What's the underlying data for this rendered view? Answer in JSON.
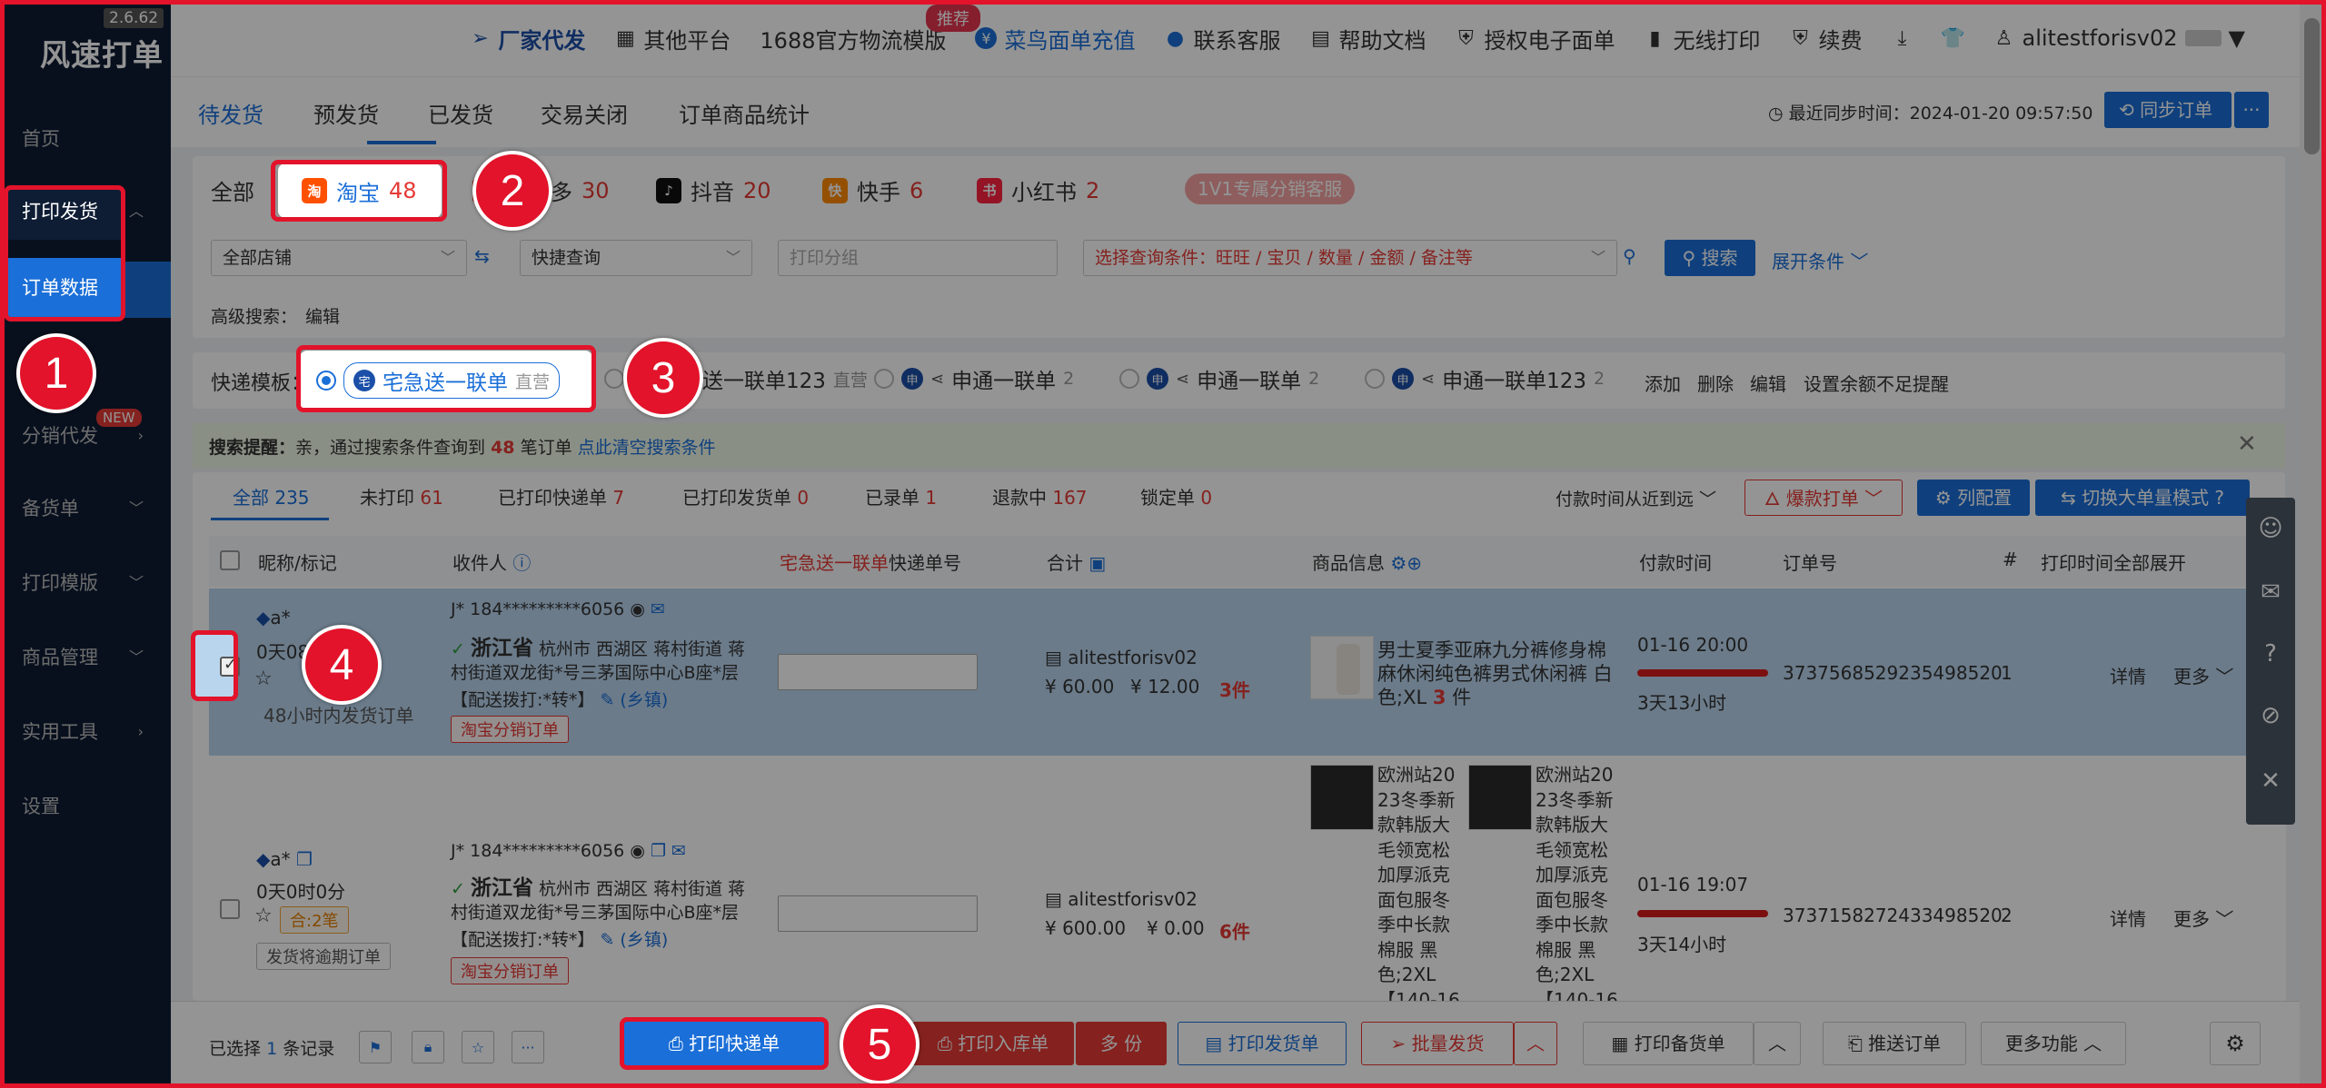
{
  "app": {
    "name": "风速打单",
    "version": "2.6.62"
  },
  "sidebar": {
    "items": [
      {
        "label": "首页"
      },
      {
        "label": "打印发货"
      },
      {
        "label": "订单数据"
      },
      {
        "label": "分销代发",
        "badge": "NEW"
      },
      {
        "label": "备货单"
      },
      {
        "label": "打印模版"
      },
      {
        "label": "商品管理"
      },
      {
        "label": "实用工具"
      },
      {
        "label": "设置"
      }
    ]
  },
  "topbar": {
    "items": [
      {
        "label": "厂家代发",
        "icon": "send-icon"
      },
      {
        "label": "其他平台",
        "icon": "grid-icon"
      },
      {
        "label": "1688官方物流模版",
        "badge": "推荐"
      },
      {
        "label": "菜鸟面单充值",
        "icon": "yen-icon"
      },
      {
        "label": "联系客服",
        "icon": "headset-icon"
      },
      {
        "label": "帮助文档",
        "icon": "doc-icon"
      },
      {
        "label": "授权电子面单",
        "icon": "shield-icon"
      },
      {
        "label": "无线打印",
        "icon": "phone-icon"
      },
      {
        "label": "续费",
        "icon": "shield-yen-icon"
      }
    ],
    "user": "alitestforisv02"
  },
  "tabs": [
    {
      "label": "待发货",
      "active": true
    },
    {
      "label": "预发货"
    },
    {
      "label": "已发货"
    },
    {
      "label": "交易关闭"
    },
    {
      "label": "订单商品统计"
    }
  ],
  "sync": {
    "label": "最近同步时间：2024-01-20 09:57:50",
    "button": "同步订单",
    "more": "···"
  },
  "platforms": [
    {
      "label": "全部"
    },
    {
      "label": "淘宝",
      "count": "48",
      "color": "#ff5000",
      "icon": "淘"
    },
    {
      "label": "拼多多",
      "count": "30",
      "color": "#e02e24",
      "icon": "拼"
    },
    {
      "label": "抖音",
      "count": "20",
      "color": "#111111",
      "icon": "♪"
    },
    {
      "label": "快手",
      "count": "6",
      "color": "#ff8a00",
      "icon": "快"
    },
    {
      "label": "小红书",
      "count": "2",
      "color": "#ff2442",
      "icon": "书"
    }
  ],
  "vip_service": "1V1专属分销客服",
  "search": {
    "shop_select": "全部店铺",
    "quick_select": "快捷查询",
    "group_placeholder": "打印分组",
    "condition_placeholder": "选择查询条件：旺旺 / 宝贝 / 数量 / 金额 / 备注等",
    "search_button": "搜索",
    "expand": "展开条件",
    "advanced_label": "高级搜索：",
    "advanced_edit": "编辑"
  },
  "templates": {
    "label": "快递模板：",
    "items": [
      {
        "name": "宅急送一联单",
        "sub": "直营",
        "selected": true
      },
      {
        "name": "宅急送一联单123",
        "sub": "直营"
      },
      {
        "name": "申通一联单",
        "sub": "2"
      },
      {
        "name": "申通一联单",
        "sub": "2"
      },
      {
        "name": "申通一联单123",
        "sub": "2"
      }
    ],
    "actions": [
      "添加",
      "删除",
      "编辑",
      "设置余额不足提醒"
    ]
  },
  "notice": {
    "prefix": "搜索提醒：",
    "text1": "亲，通过搜索条件查询到",
    "count": "48",
    "text2": "笔订单",
    "clear": "点此清空搜索条件"
  },
  "filters": [
    {
      "label": "全部",
      "count": "235",
      "active": true
    },
    {
      "label": "未打印",
      "count": "61"
    },
    {
      "label": "已打印快递单",
      "count": "7"
    },
    {
      "label": "已打印发货单",
      "count": "0"
    },
    {
      "label": "已录单",
      "count": "1"
    },
    {
      "label": "退款中",
      "count": "167"
    },
    {
      "label": "锁定单",
      "count": "0"
    }
  ],
  "sort": "付款时间从近到远",
  "list_actions": {
    "hot": "爆款打单",
    "columns": "列配置",
    "mode": "切换大单量模式"
  },
  "table": {
    "headers": {
      "nick": "昵称/标记",
      "receiver": "收件人",
      "tracking_prefix": "宅急送一联单",
      "tracking_suffix": "快递单号",
      "total": "合计",
      "goods": "商品信息",
      "paytime": "付款时间",
      "order_no": "订单号",
      "index": "#",
      "print_time": "打印时间",
      "expand_all": "全部展开"
    },
    "rows": [
      {
        "nick": "a*",
        "wait": "0天08",
        "remain": "48小时内发货订单",
        "phone": "J* 184*********6056",
        "province": "浙江省",
        "addr1": "杭州市 西湖区 蒋村街道 蒋",
        "addr2": "村街道双龙街*号三茅国际中心B座*层",
        "addr3": "【配送拨打:*转*】",
        "village": "(乡镇)",
        "tag": "淘宝分销订单",
        "shop": "alitestforisv02",
        "price": "¥ 60.00",
        "post": "¥ 12.00",
        "qty": "3件",
        "goods": [
          {
            "lines": [
              "男士夏季亚麻九分裤修身棉",
              "麻休闲纯色裤男式休闲裤 白",
              "色;XL"
            ],
            "qty": "3",
            "unit": "件"
          }
        ],
        "paytime": "01-16 20:00",
        "paywait": "3天13小时",
        "progress": 1.0,
        "order_no": "3737568529235498520",
        "index": "1",
        "detail": "详情",
        "more": "更多"
      },
      {
        "nick": "a*",
        "wait": "0天0时0分",
        "merge": "合:2笔",
        "overdue": "发货将逾期订单",
        "phone": "J* 184*********6056",
        "province": "浙江省",
        "addr1": "杭州市 西湖区 蒋村街道 蒋",
        "addr2": "村街道双龙街*号三茅国际中心B座*层",
        "addr3": "【配送拨打:*转*】",
        "village": "(乡镇)",
        "tag": "淘宝分销订单",
        "shop": "alitestforisv02",
        "price": "¥ 600.00",
        "post": "¥ 0.00",
        "qty": "6件",
        "goods": [
          {
            "lines": [
              "欧洲站20",
              "23冬季新",
              "款韩版大",
              "毛领宽松",
              "加厚派克",
              "面包服冬",
              "季中长款",
              "棉服 黑",
              "色;2XL",
              "【140-16"
            ]
          },
          {
            "lines": [
              "欧洲站20",
              "23冬季新",
              "款韩版大",
              "毛领宽松",
              "加厚派克",
              "面包服冬",
              "季中长款",
              "棉服 黑",
              "色;2XL",
              "【140-16"
            ]
          }
        ],
        "paytime": "01-16 19:07",
        "paywait": "3天14小时",
        "progress": 1.0,
        "order_no": "3737158272433498520",
        "index": "2",
        "detail": "详情",
        "more": "更多"
      }
    ]
  },
  "bottom": {
    "selected_prefix": "已选择",
    "selected_count": "1",
    "selected_suffix": "条记录",
    "print_express": "打印快递单",
    "print_warehouse": "打印入库单",
    "copies": "多 份",
    "print_delivery": "打印发货单",
    "batch_ship": "批量发货",
    "print_stock": "打印备货单",
    "push_order": "推送订单",
    "more_func": "更多功能"
  },
  "steps": [
    "1",
    "2",
    "3",
    "4",
    "5"
  ],
  "colors": {
    "accent": "#1b6fd8",
    "highlight": "#e2132a",
    "sidebar": "#0e1d34",
    "alert": "#e53935"
  }
}
